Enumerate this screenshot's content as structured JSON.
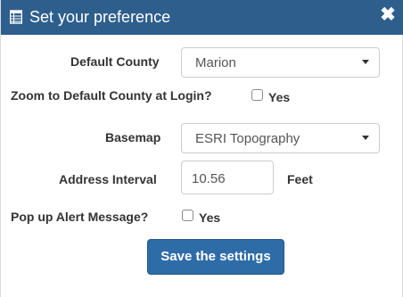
{
  "dialog": {
    "title": "Set your preference",
    "close_glyph": "✖",
    "title_icon": "table-icon"
  },
  "form": {
    "default_county": {
      "label": "Default County",
      "value": "Marion"
    },
    "zoom_login": {
      "label": "Zoom to Default County at Login?",
      "checked": false,
      "option_label": "Yes"
    },
    "basemap": {
      "label": "Basemap",
      "value": "ESRI Topography"
    },
    "address_interval": {
      "label": "Address Interval",
      "value": "10.56",
      "unit": "Feet"
    },
    "popup_alert": {
      "label": "Pop up Alert Message?",
      "checked": false,
      "option_label": "Yes"
    }
  },
  "actions": {
    "save_label": "Save the settings"
  },
  "colors": {
    "title_bar": "#2e5f8c",
    "button": "#2e6ca8"
  }
}
